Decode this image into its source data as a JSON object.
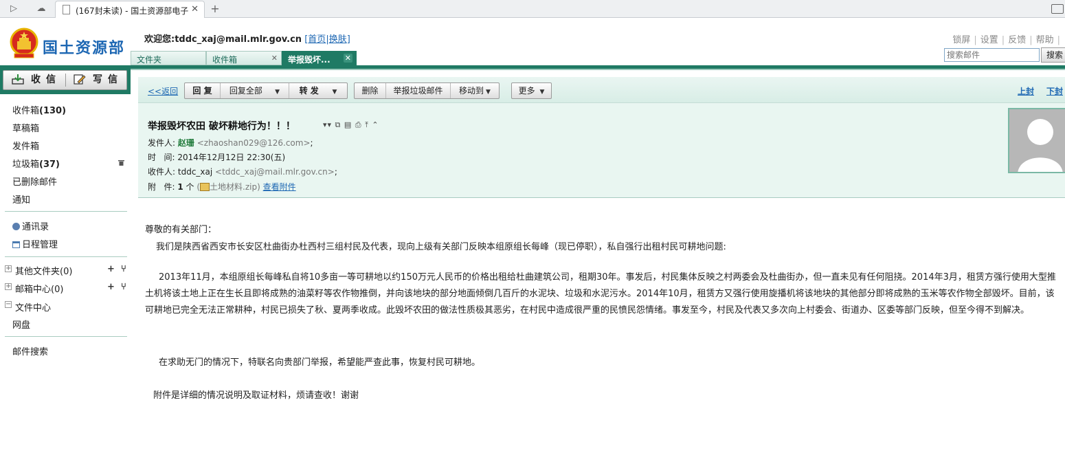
{
  "browser": {
    "tab_title": "(167封未读) - 国土资源部电子",
    "close": "✕",
    "new_tab": "+"
  },
  "header": {
    "logo_text": "国土资源部",
    "welcome_prefix": "欢迎您:",
    "user": "tddc_xaj@mail.mlr.gov.cn",
    "link_home": "首页",
    "link_skin": "换肤",
    "bracket_open": "[",
    "bracket_sep": "|",
    "bracket_close": "]",
    "top_links": [
      "锁屏",
      "设置",
      "反馈",
      "帮助"
    ],
    "search_placeholder": "搜索邮件",
    "search_button": "搜索"
  },
  "folder_tabs": [
    {
      "label": "文件夹"
    },
    {
      "label": "收件箱",
      "close": "✕"
    },
    {
      "label": "举报毁坏...",
      "close": "✕"
    }
  ],
  "sidebar": {
    "receive_label": "收信",
    "write_label": "写信",
    "folders": [
      {
        "label": "收件箱",
        "count": "(130)"
      },
      {
        "label": "草稿箱"
      },
      {
        "label": "发件箱"
      },
      {
        "label": "垃圾箱",
        "count": "(37)"
      },
      {
        "label": "已删除邮件"
      },
      {
        "label": "通知"
      }
    ],
    "contacts": "通讯录",
    "calendar": "日程管理",
    "other_folders": "其他文件夹(0)",
    "mailbox_center": "邮箱中心(0)",
    "file_center": "文件中心",
    "netdisk": "网盘",
    "mail_search": "邮件搜索",
    "tool_plus": "+",
    "tool_fork": "⑂",
    "expand_plus": "+",
    "expand_minus": "−"
  },
  "toolbar": {
    "back": "<<返回",
    "reply": "回 复",
    "reply_all": "回复全部",
    "forward": "转 发",
    "delete": "删除",
    "report_spam": "举报垃圾邮件",
    "move_to": "移动到",
    "more": "更多",
    "prev": "上封",
    "next": "下封",
    "dropdown": "▼"
  },
  "mail": {
    "subject": "举报毁坏农田  破坏耕地行为！！！",
    "subject_icons": "▾▾ ⧉ ▤ ⎙ ⤒ ⌃",
    "from_label": "发件人:",
    "from_name": "赵珊",
    "from_addr": "<zhaoshan029@126.com>",
    "semicolon": ";",
    "time_label": "时   间:",
    "time": "2014年12月12日  22:30(五)",
    "to_label": "收件人:",
    "to_name": "tddc_xaj",
    "to_addr": "<tddc_xaj@mail.mlr.gov.cn>",
    "attach_label": "附   件:",
    "attach_count": "1",
    "attach_unit": "个",
    "attach_paren_open": "(",
    "attach_file": "土地材料.zip)",
    "attach_view": "查看附件"
  },
  "body": {
    "greeting": "尊敬的有关部门：",
    "intro": "我们是陕西省西安市长安区杜曲街办杜西村三组村民及代表，现向上级有关部门反映本组原组长每峰（现已停职），私自强行出租村民可耕地问题:",
    "para1": "2013年11月，本组原组长每峰私自将10多亩一等可耕地以约150万元人民币的价格出租给杜曲建筑公司，租期30年。事发后，村民集体反映之村两委会及杜曲街办，但一直未见有任何阻挠。2014年3月，租赁方强行使用大型推土机将该土地上正在生长且即将成熟的油菜籽等农作物推倒，并向该地块的部分地面倾倒几百斤的水泥块、垃圾和水泥污水。2014年10月，租赁方又强行使用旋播机将该地块的其他部分即将成熟的玉米等农作物全部毁坏。目前，该可耕地已完全无法正常耕种，村民已损失了秋、夏两季收成。此毁坏农田的做法性质极其恶劣，在村民中造成很严重的民愤民怨情绪。事发至今，村民及代表又多次向上村委会、街道办、区委等部门反映，但至今得不到解决。",
    "para2": "在求助无门的情况下，特联名向贵部门举报，希望能严查此事，恢复村民可耕地。",
    "closing": "附件是详细的情况说明及取证材料，烦请查收！谢谢"
  }
}
